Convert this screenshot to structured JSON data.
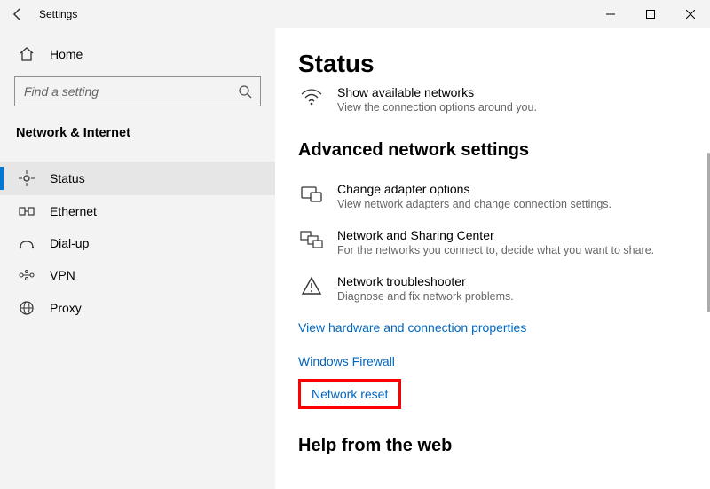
{
  "window": {
    "title": "Settings"
  },
  "sidebar": {
    "home": "Home",
    "search_placeholder": "Find a setting",
    "category": "Network & Internet",
    "items": [
      {
        "label": "Status",
        "icon": "status",
        "active": true
      },
      {
        "label": "Ethernet",
        "icon": "ethernet",
        "active": false
      },
      {
        "label": "Dial-up",
        "icon": "dialup",
        "active": false
      },
      {
        "label": "VPN",
        "icon": "vpn",
        "active": false
      },
      {
        "label": "Proxy",
        "icon": "proxy",
        "active": false
      }
    ]
  },
  "main": {
    "title": "Status",
    "top_option": {
      "title": "Show available networks",
      "subtitle": "View the connection options around you."
    },
    "section_heading": "Advanced network settings",
    "options": [
      {
        "title": "Change adapter options",
        "subtitle": "View network adapters and change connection settings."
      },
      {
        "title": "Network and Sharing Center",
        "subtitle": "For the networks you connect to, decide what you want to share."
      },
      {
        "title": "Network troubleshooter",
        "subtitle": "Diagnose and fix network problems."
      }
    ],
    "links": {
      "view_hw": "View hardware and connection properties",
      "firewall": "Windows Firewall",
      "reset": "Network reset"
    },
    "help_heading": "Help from the web"
  }
}
